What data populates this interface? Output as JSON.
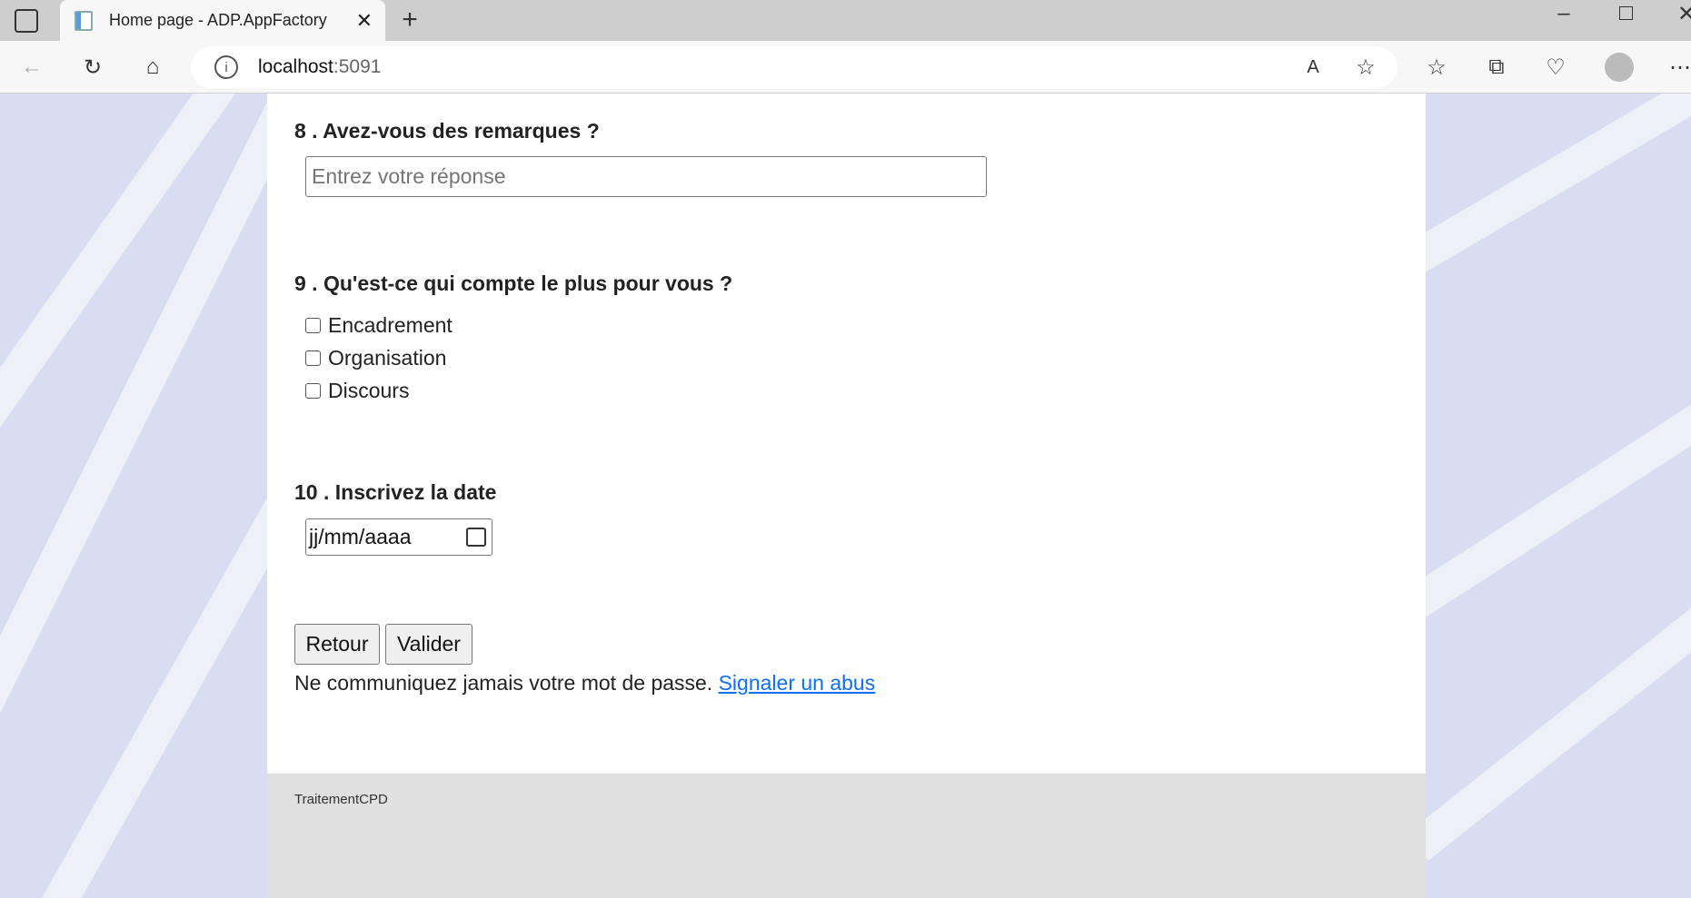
{
  "browser": {
    "tab_title": "Home page - ADP.AppFactory",
    "url_host": "localhost",
    "url_port": ":5091"
  },
  "form": {
    "q8": {
      "label": "8 . Avez-vous des remarques ?",
      "placeholder": "Entrez votre réponse"
    },
    "q9": {
      "label": "9 . Qu'est-ce qui compte le plus pour vous ?",
      "options": [
        "Encadrement",
        "Organisation",
        "Discours"
      ]
    },
    "q10": {
      "label": "10 . Inscrivez la date",
      "placeholder": "jj/mm/aaaa"
    },
    "back_label": "Retour",
    "submit_label": "Valider",
    "note": "Ne communiquez jamais votre mot de passe.",
    "abuse_link": "Signaler un abus"
  },
  "footer": {
    "text": "TraitementCPD"
  },
  "colors": {
    "link": "#0d6efd",
    "background": "#d8ddf1",
    "footer": "#e0e0e0"
  }
}
